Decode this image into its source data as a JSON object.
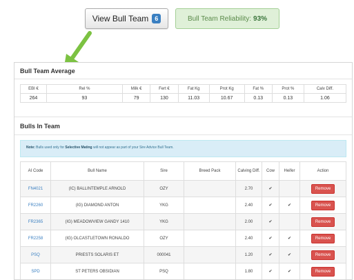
{
  "topbar": {
    "view_label": "View Bull Team",
    "count": "6",
    "reliability_label": "Bull Team Reliability:",
    "reliability_value": "93%"
  },
  "average": {
    "title": "Bull Team Average",
    "headers": [
      "EBI €",
      "Rel %",
      "Milk €",
      "Fert €",
      "Fat Kg",
      "Prot Kg",
      "Fat %",
      "Prot %",
      "Calv Diff."
    ],
    "values": [
      "264",
      "93",
      "79",
      "130",
      "11.03",
      "10.67",
      "0.13",
      "0.13",
      "1.06"
    ]
  },
  "bulls": {
    "title": "Bulls In Team",
    "note_label": "Note:",
    "note_text": "Bulls used only for",
    "note_bold": "Selective Mating",
    "note_rest": "will not appear as part of your Sire Advice Bull Team.",
    "headers": [
      "AI Code",
      "Bull Name",
      "Sire",
      "Breed Pack",
      "Calving Diff.",
      "Cow",
      "Heifer",
      "Action"
    ],
    "rows": [
      {
        "code": "FN4021",
        "name": "(IC) BALLINTEMPLE ARNOLD",
        "sire": "OZY",
        "pack": "",
        "calving": "2.70",
        "cow": "✔",
        "heifer": "",
        "action": "Remove"
      },
      {
        "code": "FR2260",
        "name": "(IG) DIAMOND ANTON",
        "sire": "YKG",
        "pack": "",
        "calving": "2.40",
        "cow": "✔",
        "heifer": "✔",
        "action": "Remove"
      },
      {
        "code": "FR2365",
        "name": "(IG) MEADOWVIEW GANDY 1410",
        "sire": "YKG",
        "pack": "",
        "calving": "2.00",
        "cow": "✔",
        "heifer": "",
        "action": "Remove"
      },
      {
        "code": "FR2258",
        "name": "(IG) OLCASTLETOWN RONALDO",
        "sire": "OZY",
        "pack": "",
        "calving": "2.40",
        "cow": "✔",
        "heifer": "✔",
        "action": "Remove"
      },
      {
        "code": "PSQ",
        "name": "PRIESTS SOLARIS ET",
        "sire": "000041",
        "pack": "",
        "calving": "1.20",
        "cow": "✔",
        "heifer": "✔",
        "action": "Remove"
      },
      {
        "code": "SPD",
        "name": "ST PETERS OBSIDIAN",
        "sire": "PSQ",
        "pack": "",
        "calving": "1.80",
        "cow": "✔",
        "heifer": "✔",
        "action": "Remove"
      }
    ]
  },
  "colors": {
    "accent": "#3a7fc1",
    "success_bg": "#dff0d8",
    "danger": "#d9534f",
    "arrow": "#7cc242"
  }
}
